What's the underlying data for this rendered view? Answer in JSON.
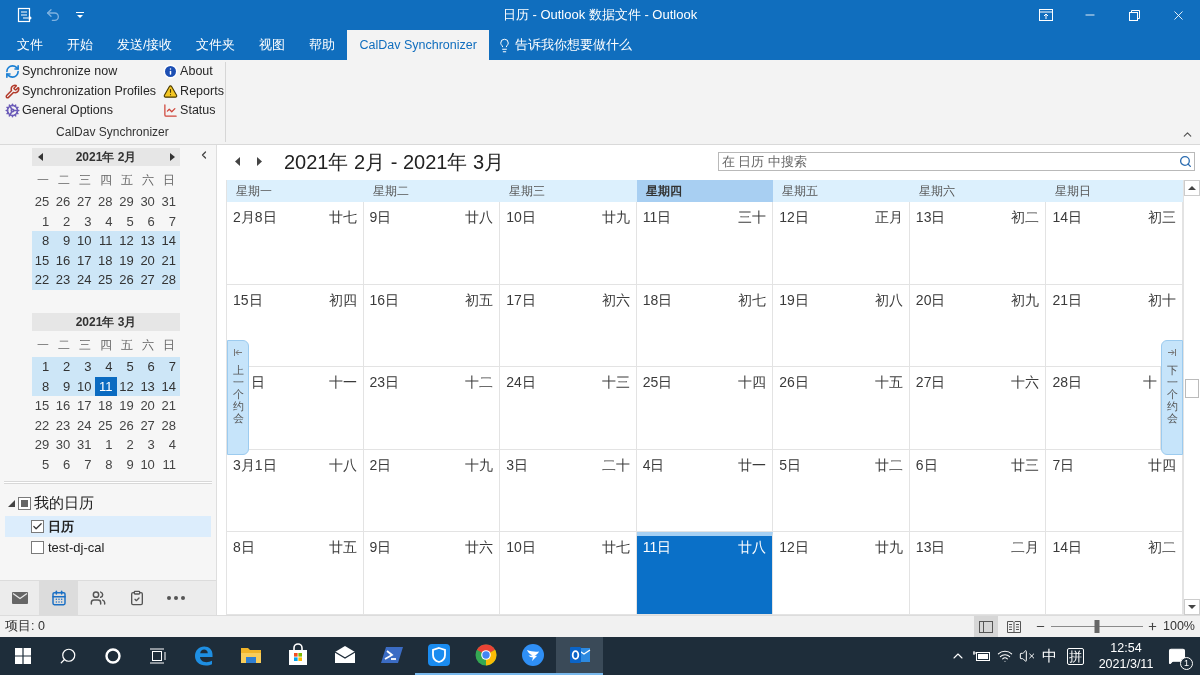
{
  "window": {
    "title": "日历 - Outlook 数据文件 - Outlook"
  },
  "ribbon": {
    "tabs": [
      {
        "label": "文件",
        "selected": false
      },
      {
        "label": "开始",
        "selected": false
      },
      {
        "label": "发送/接收",
        "selected": false
      },
      {
        "label": "文件夹",
        "selected": false
      },
      {
        "label": "视图",
        "selected": false
      },
      {
        "label": "帮助",
        "selected": false
      },
      {
        "label": "CalDav Synchronizer",
        "selected": true
      }
    ],
    "tell_me": {
      "placeholder": "告诉我你想要做什么"
    },
    "group": {
      "label": "CalDav Synchronizer",
      "columns": [
        {
          "buttons": [
            {
              "kind": "sync",
              "label": "Synchronize now"
            },
            {
              "kind": "profiles",
              "label": "Synchronization Profiles"
            },
            {
              "kind": "options",
              "label": "General Options"
            }
          ]
        },
        {
          "buttons": [
            {
              "kind": "about",
              "label": "About"
            },
            {
              "kind": "reports",
              "label": "Reports"
            },
            {
              "kind": "status",
              "label": "Status"
            }
          ]
        }
      ]
    }
  },
  "navigator": {
    "months": [
      {
        "title": "2021年 2月",
        "nav_arrows": true,
        "weekdays": [
          "一",
          "二",
          "三",
          "四",
          "五",
          "六",
          "日"
        ],
        "weeks": [
          {
            "selected": false,
            "days": [
              {
                "label": "25",
                "today": false
              },
              {
                "label": "26",
                "today": false
              },
              {
                "label": "27",
                "today": false
              },
              {
                "label": "28",
                "today": false
              },
              {
                "label": "29",
                "today": false
              },
              {
                "label": "30",
                "today": false
              },
              {
                "label": "31",
                "today": false
              }
            ]
          },
          {
            "selected": false,
            "days": [
              {
                "label": "1",
                "today": false
              },
              {
                "label": "2",
                "today": false
              },
              {
                "label": "3",
                "today": false
              },
              {
                "label": "4",
                "today": false
              },
              {
                "label": "5",
                "today": false
              },
              {
                "label": "6",
                "today": false
              },
              {
                "label": "7",
                "today": false
              }
            ]
          },
          {
            "selected": true,
            "days": [
              {
                "label": "8",
                "today": false
              },
              {
                "label": "9",
                "today": false
              },
              {
                "label": "10",
                "today": false
              },
              {
                "label": "11",
                "today": false
              },
              {
                "label": "12",
                "today": false
              },
              {
                "label": "13",
                "today": false
              },
              {
                "label": "14",
                "today": false
              }
            ]
          },
          {
            "selected": true,
            "days": [
              {
                "label": "15",
                "today": false
              },
              {
                "label": "16",
                "today": false
              },
              {
                "label": "17",
                "today": false
              },
              {
                "label": "18",
                "today": false
              },
              {
                "label": "19",
                "today": false
              },
              {
                "label": "20",
                "today": false
              },
              {
                "label": "21",
                "today": false
              }
            ]
          },
          {
            "selected": true,
            "days": [
              {
                "label": "22",
                "today": false
              },
              {
                "label": "23",
                "today": false
              },
              {
                "label": "24",
                "today": false
              },
              {
                "label": "25",
                "today": false
              },
              {
                "label": "26",
                "today": false
              },
              {
                "label": "27",
                "today": false
              },
              {
                "label": "28",
                "today": false
              }
            ]
          }
        ]
      },
      {
        "title": "2021年 3月",
        "nav_arrows": false,
        "weekdays": [
          "一",
          "二",
          "三",
          "四",
          "五",
          "六",
          "日"
        ],
        "weeks": [
          {
            "selected": true,
            "days": [
              {
                "label": "1",
                "today": false
              },
              {
                "label": "2",
                "today": false
              },
              {
                "label": "3",
                "today": false
              },
              {
                "label": "4",
                "today": false
              },
              {
                "label": "5",
                "today": false
              },
              {
                "label": "6",
                "today": false
              },
              {
                "label": "7",
                "today": false
              }
            ]
          },
          {
            "selected": true,
            "days": [
              {
                "label": "8",
                "today": false
              },
              {
                "label": "9",
                "today": false
              },
              {
                "label": "10",
                "today": false
              },
              {
                "label": "11",
                "today": true
              },
              {
                "label": "12",
                "today": false
              },
              {
                "label": "13",
                "today": false
              },
              {
                "label": "14",
                "today": false
              }
            ]
          },
          {
            "selected": false,
            "days": [
              {
                "label": "15",
                "today": false
              },
              {
                "label": "16",
                "today": false
              },
              {
                "label": "17",
                "today": false
              },
              {
                "label": "18",
                "today": false
              },
              {
                "label": "19",
                "today": false
              },
              {
                "label": "20",
                "today": false
              },
              {
                "label": "21",
                "today": false
              }
            ]
          },
          {
            "selected": false,
            "days": [
              {
                "label": "22",
                "today": false
              },
              {
                "label": "23",
                "today": false
              },
              {
                "label": "24",
                "today": false
              },
              {
                "label": "25",
                "today": false
              },
              {
                "label": "26",
                "today": false
              },
              {
                "label": "27",
                "today": false
              },
              {
                "label": "28",
                "today": false
              }
            ]
          },
          {
            "selected": false,
            "days": [
              {
                "label": "29",
                "today": false
              },
              {
                "label": "30",
                "today": false
              },
              {
                "label": "31",
                "today": false
              },
              {
                "label": "1",
                "today": false
              },
              {
                "label": "2",
                "today": false
              },
              {
                "label": "3",
                "today": false
              },
              {
                "label": "4",
                "today": false
              }
            ]
          },
          {
            "selected": false,
            "days": [
              {
                "label": "5",
                "today": false
              },
              {
                "label": "6",
                "today": false
              },
              {
                "label": "7",
                "today": false
              },
              {
                "label": "8",
                "today": false
              },
              {
                "label": "9",
                "today": false
              },
              {
                "label": "10",
                "today": false
              },
              {
                "label": "11",
                "today": false
              }
            ]
          }
        ]
      }
    ]
  },
  "calendars": {
    "label": "我的日历",
    "expanded": true,
    "indeterminate": true,
    "items": [
      {
        "label": "日历",
        "checked": true,
        "selected": true
      },
      {
        "label": "test-dj-cal",
        "checked": false,
        "selected": false
      }
    ]
  },
  "nav_bar": {
    "items": [
      {
        "kind": "mail",
        "selected": false
      },
      {
        "kind": "calendar",
        "selected": true
      },
      {
        "kind": "people",
        "selected": false
      },
      {
        "kind": "tasks",
        "selected": false
      },
      {
        "kind": "more",
        "selected": false
      }
    ]
  },
  "calendar": {
    "title": "2021年 2月 - 2021年 3月",
    "search": {
      "placeholder": "在 日历 中搜索"
    },
    "weekdays": [
      {
        "label": "星期一",
        "selected": false
      },
      {
        "label": "星期二",
        "selected": false
      },
      {
        "label": "星期三",
        "selected": false
      },
      {
        "label": "星期四",
        "selected": true
      },
      {
        "label": "星期五",
        "selected": false
      },
      {
        "label": "星期六",
        "selected": false
      },
      {
        "label": "星期日",
        "selected": false
      }
    ],
    "weeks": [
      [
        {
          "date": "2月8日",
          "lunar": "廿七",
          "selected": false
        },
        {
          "date": "9日",
          "lunar": "廿八",
          "selected": false
        },
        {
          "date": "10日",
          "lunar": "廿九",
          "selected": false
        },
        {
          "date": "11日",
          "lunar": "三十",
          "selected": false
        },
        {
          "date": "12日",
          "lunar": "正月",
          "selected": false
        },
        {
          "date": "13日",
          "lunar": "初二",
          "selected": false
        },
        {
          "date": "14日",
          "lunar": "初三",
          "selected": false
        }
      ],
      [
        {
          "date": "15日",
          "lunar": "初四",
          "selected": false
        },
        {
          "date": "16日",
          "lunar": "初五",
          "selected": false
        },
        {
          "date": "17日",
          "lunar": "初六",
          "selected": false
        },
        {
          "date": "18日",
          "lunar": "初七",
          "selected": false
        },
        {
          "date": "19日",
          "lunar": "初八",
          "selected": false
        },
        {
          "date": "20日",
          "lunar": "初九",
          "selected": false
        },
        {
          "date": "21日",
          "lunar": "初十",
          "selected": false
        }
      ],
      [
        {
          "date": "日",
          "lunar": "十一",
          "selected": false
        },
        {
          "date": "23日",
          "lunar": "十二",
          "selected": false
        },
        {
          "date": "24日",
          "lunar": "十三",
          "selected": false
        },
        {
          "date": "25日",
          "lunar": "十四",
          "selected": false
        },
        {
          "date": "26日",
          "lunar": "十五",
          "selected": false
        },
        {
          "date": "27日",
          "lunar": "十六",
          "selected": false
        },
        {
          "date": "28日",
          "lunar": "十",
          "selected": false
        }
      ],
      [
        {
          "date": "3月1日",
          "lunar": "十八",
          "selected": false
        },
        {
          "date": "2日",
          "lunar": "十九",
          "selected": false
        },
        {
          "date": "3日",
          "lunar": "二十",
          "selected": false
        },
        {
          "date": "4日",
          "lunar": "廿一",
          "selected": false
        },
        {
          "date": "5日",
          "lunar": "廿二",
          "selected": false
        },
        {
          "date": "6日",
          "lunar": "廿三",
          "selected": false
        },
        {
          "date": "7日",
          "lunar": "廿四",
          "selected": false
        }
      ],
      [
        {
          "date": "8日",
          "lunar": "廿五",
          "selected": false
        },
        {
          "date": "9日",
          "lunar": "廿六",
          "selected": false
        },
        {
          "date": "10日",
          "lunar": "廿七",
          "selected": false
        },
        {
          "date": "11日",
          "lunar": "廿八",
          "selected": true
        },
        {
          "date": "12日",
          "lunar": "廿九",
          "selected": false
        },
        {
          "date": "13日",
          "lunar": "二月",
          "selected": false
        },
        {
          "date": "14日",
          "lunar": "初二",
          "selected": false
        }
      ]
    ],
    "side_tabs": [
      {
        "label": "上一个约会"
      },
      {
        "label": "下一个约会"
      }
    ]
  },
  "status_bar": {
    "items": "项目: 0",
    "views": [
      {
        "kind": "normal",
        "selected": true
      },
      {
        "kind": "reading",
        "selected": false
      }
    ],
    "zoom": {
      "level": 0.5,
      "reading": "100%"
    }
  },
  "taskbar": {
    "apps": [
      {
        "kind": "edge",
        "running": false,
        "active": false
      },
      {
        "kind": "explorer",
        "running": false,
        "active": false
      },
      {
        "kind": "store",
        "running": false,
        "active": false
      },
      {
        "kind": "mail",
        "running": false,
        "active": false
      },
      {
        "kind": "powershell",
        "running": false,
        "active": false
      },
      {
        "kind": "shield",
        "running": true,
        "active": false
      },
      {
        "kind": "chrome",
        "running": true,
        "active": false
      },
      {
        "kind": "dingtalk",
        "running": true,
        "active": false
      },
      {
        "kind": "outlook",
        "running": true,
        "active": true
      }
    ],
    "tray": {
      "ime_mode": "中",
      "ime_icon": "拼",
      "time": "12:54",
      "date": "2021/3/11",
      "notification_count": "1"
    }
  }
}
